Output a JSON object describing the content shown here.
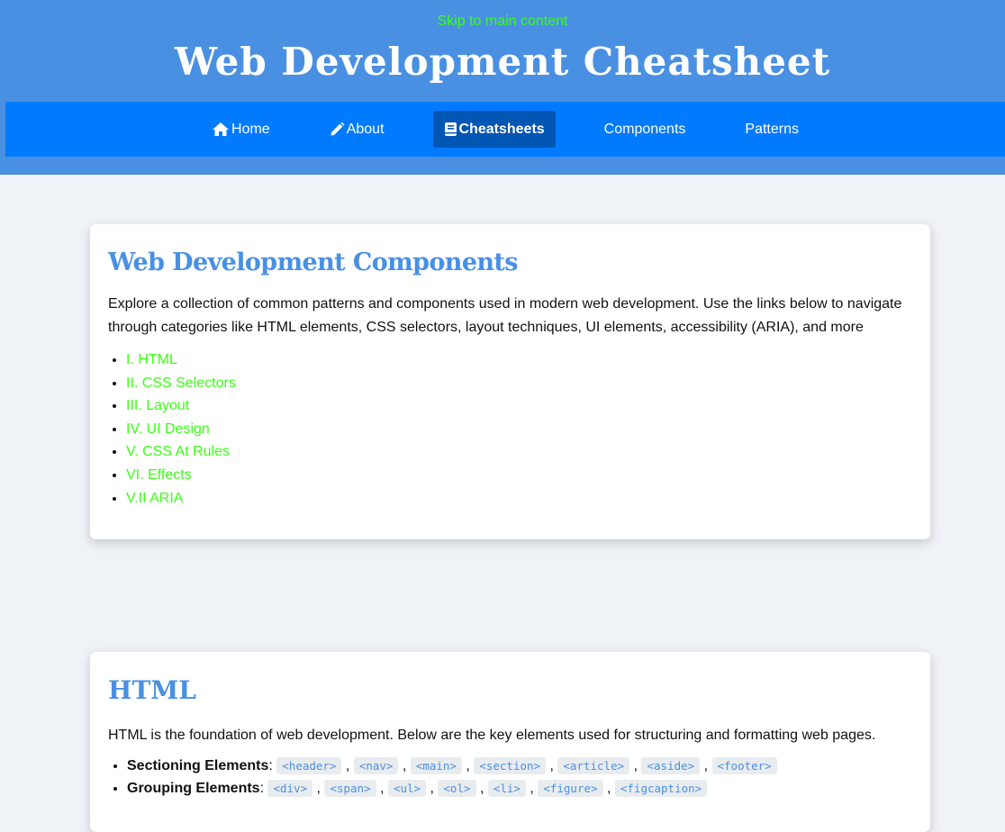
{
  "header": {
    "skip_link": "Skip to main content",
    "title": "Web Development Cheatsheet"
  },
  "nav": {
    "items": [
      {
        "label": "Home",
        "icon": "home-icon"
      },
      {
        "label": "About",
        "icon": "pencil-icon"
      },
      {
        "label": "Cheatsheets",
        "icon": "book-icon",
        "active": true
      },
      {
        "label": "Components"
      },
      {
        "label": "Patterns"
      }
    ]
  },
  "intro": {
    "title": "Web Development Components",
    "text": "Explore a collection of common patterns and components used in modern web development. Use the links below to navigate through categories like HTML elements, CSS selectors, layout techniques, UI elements, accessibility (ARIA), and more",
    "links": [
      "I. HTML",
      "II. CSS Selectors",
      "III. Layout",
      "IV. UI Design",
      "V. CSS At Rules",
      "VI. Effects",
      "V.II ARIA"
    ]
  },
  "html_section": {
    "title": "HTML",
    "text": "HTML is the foundation of web development. Below are the key elements used for structuring and formatting web pages.",
    "groups": [
      {
        "label": "Sectioning Elements",
        "tags": [
          "<header>",
          "<nav>",
          "<main>",
          "<section>",
          "<article>",
          "<aside>",
          "<footer>"
        ]
      },
      {
        "label": "Grouping Elements",
        "tags": [
          "<div>",
          "<span>",
          "<ul>",
          "<ol>",
          "<li>",
          "<figure>",
          "<figcaption>"
        ]
      }
    ]
  },
  "colors": {
    "header_bg": "#4a90e2",
    "nav_bg": "#007bff",
    "nav_active_bg": "#0056b3",
    "link": "#39ff14",
    "heading": "#4a90e2",
    "page_bg": "#eff3f7"
  }
}
